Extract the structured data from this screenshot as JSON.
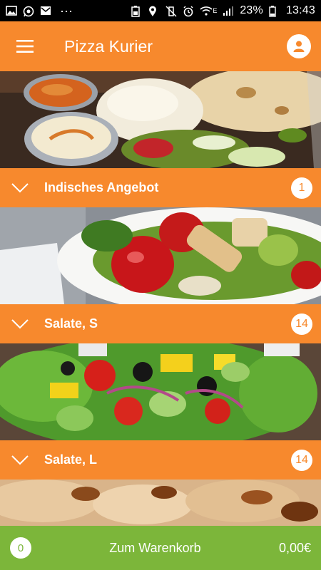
{
  "status_bar": {
    "battery_percent": "23%",
    "time": "13:43",
    "network_label": "E",
    "left_icons": [
      "gallery-icon",
      "whatsapp-icon",
      "mail-icon",
      "more-dots-icon"
    ],
    "right_icons": [
      "battery-saver-icon",
      "location-icon",
      "vibrate-off-icon",
      "alarm-icon",
      "wifi-icon",
      "signal-icon",
      "battery-icon"
    ]
  },
  "app_bar": {
    "title": "Pizza Kurier",
    "menu_icon": "hamburger-menu-icon",
    "profile_icon": "user-icon"
  },
  "categories": [
    {
      "name": "Indisches Angebot",
      "count": "1",
      "image": "indian-curry-rice-photo"
    },
    {
      "name": "Salate, S",
      "count": "14",
      "image": "chicken-salad-photo"
    },
    {
      "name": "Salate, L",
      "count": "14",
      "image": "greek-salad-photo"
    }
  ],
  "partial_next_image": "grilled-chicken-photo",
  "cart": {
    "count": "0",
    "label": "Zum Warenkorb",
    "total": "0,00€"
  },
  "colors": {
    "primary_orange": "#f7892d",
    "cart_green": "#7cb63a",
    "status_black": "#000000"
  }
}
